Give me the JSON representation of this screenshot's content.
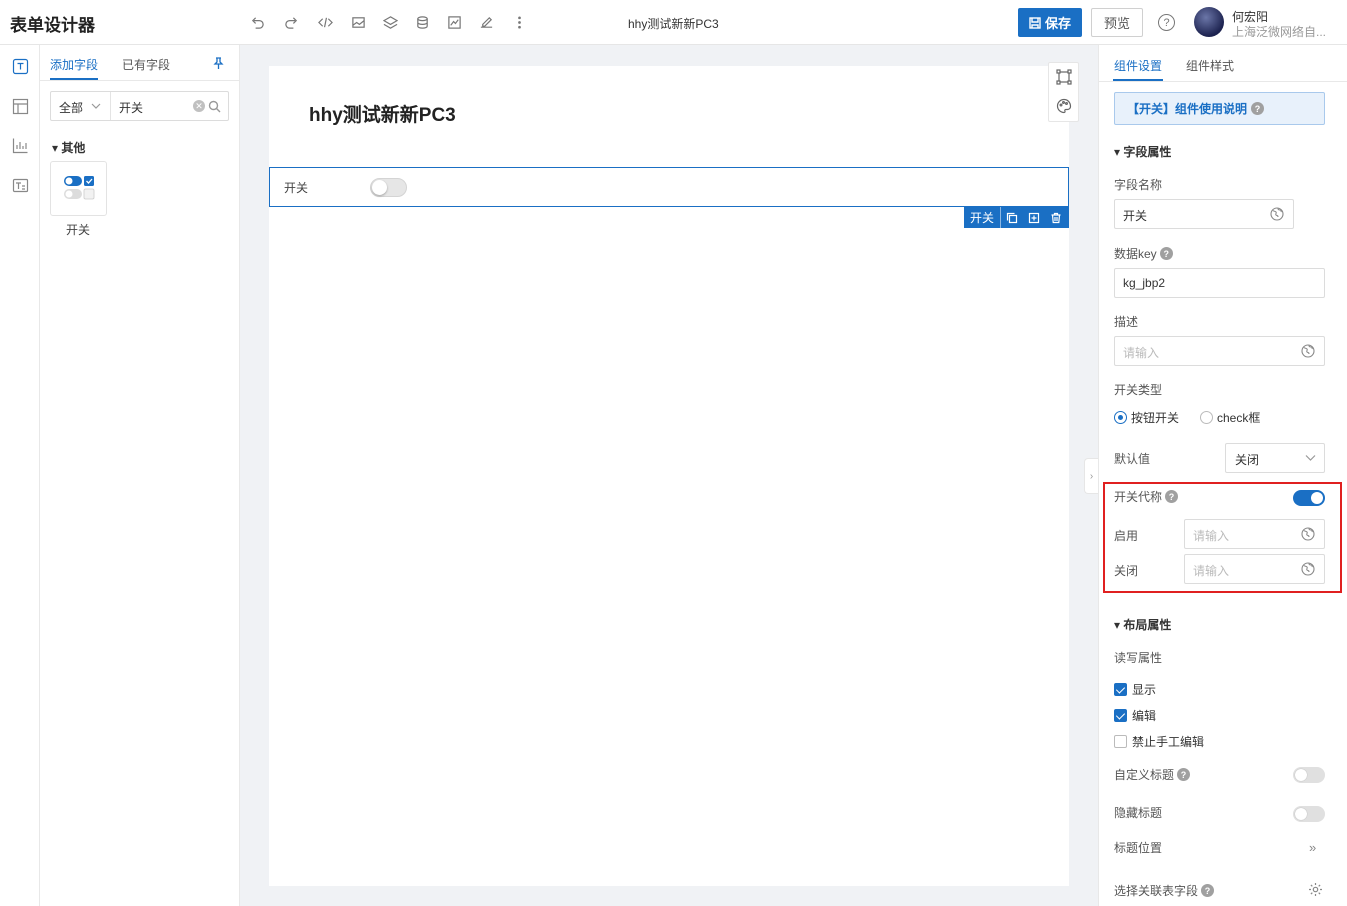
{
  "app": {
    "title": "表单设计器",
    "doc_title": "hhy测试新新PC3"
  },
  "header": {
    "toolbar_icons": [
      "undo-icon",
      "redo-icon",
      "code-icon",
      "image-icon",
      "layers-icon",
      "database-icon",
      "chart-icon",
      "edit-icon",
      "more-icon"
    ],
    "save_label": "保存",
    "preview_label": "预览",
    "help_glyph": "?",
    "user": {
      "name": "何宏阳",
      "org": "上海泛微网络自..."
    }
  },
  "left_panel": {
    "tabs": [
      "添加字段",
      "已有字段"
    ],
    "active_tab": 0,
    "search": {
      "category": "全部",
      "value": "开关"
    },
    "group": "其他",
    "components": [
      {
        "label": "开关",
        "icon": "switch-component-icon"
      }
    ]
  },
  "canvas": {
    "form_title": "hhy测试新新PC3",
    "field": {
      "label": "开关",
      "toolbar_label": "开关",
      "value": false
    }
  },
  "right_panel": {
    "tabs": [
      "组件设置",
      "组件样式"
    ],
    "active_tab": 0,
    "notice": "【开关】组件使用说明",
    "field_section": "字段属性",
    "field_name_label": "字段名称",
    "field_name_value": "开关",
    "data_key_label": "数据key",
    "data_key_value": "kg_jbp2",
    "desc_label": "描述",
    "desc_placeholder": "请输入",
    "switch_type_label": "开关类型",
    "switch_types": [
      "按钮开关",
      "check框"
    ],
    "switch_type_selected": 0,
    "default_label": "默认值",
    "default_value": "关闭",
    "alias_label": "开关代称",
    "alias_enabled": true,
    "on_label": "启用",
    "on_placeholder": "请输入",
    "off_label": "关闭",
    "off_placeholder": "请输入",
    "layout_section": "布局属性",
    "rw_label": "读写属性",
    "checkboxes": [
      {
        "label": "显示",
        "checked": true
      },
      {
        "label": "编辑",
        "checked": true
      },
      {
        "label": "禁止手工编辑",
        "checked": false
      }
    ],
    "custom_title_label": "自定义标题",
    "custom_title_on": false,
    "hide_title_label": "隐藏标题",
    "hide_title_on": false,
    "title_pos_label": "标题位置",
    "link_field_label": "选择关联表字段",
    "accent_color": "#1a6fc4",
    "highlight_color": "#e02020"
  }
}
